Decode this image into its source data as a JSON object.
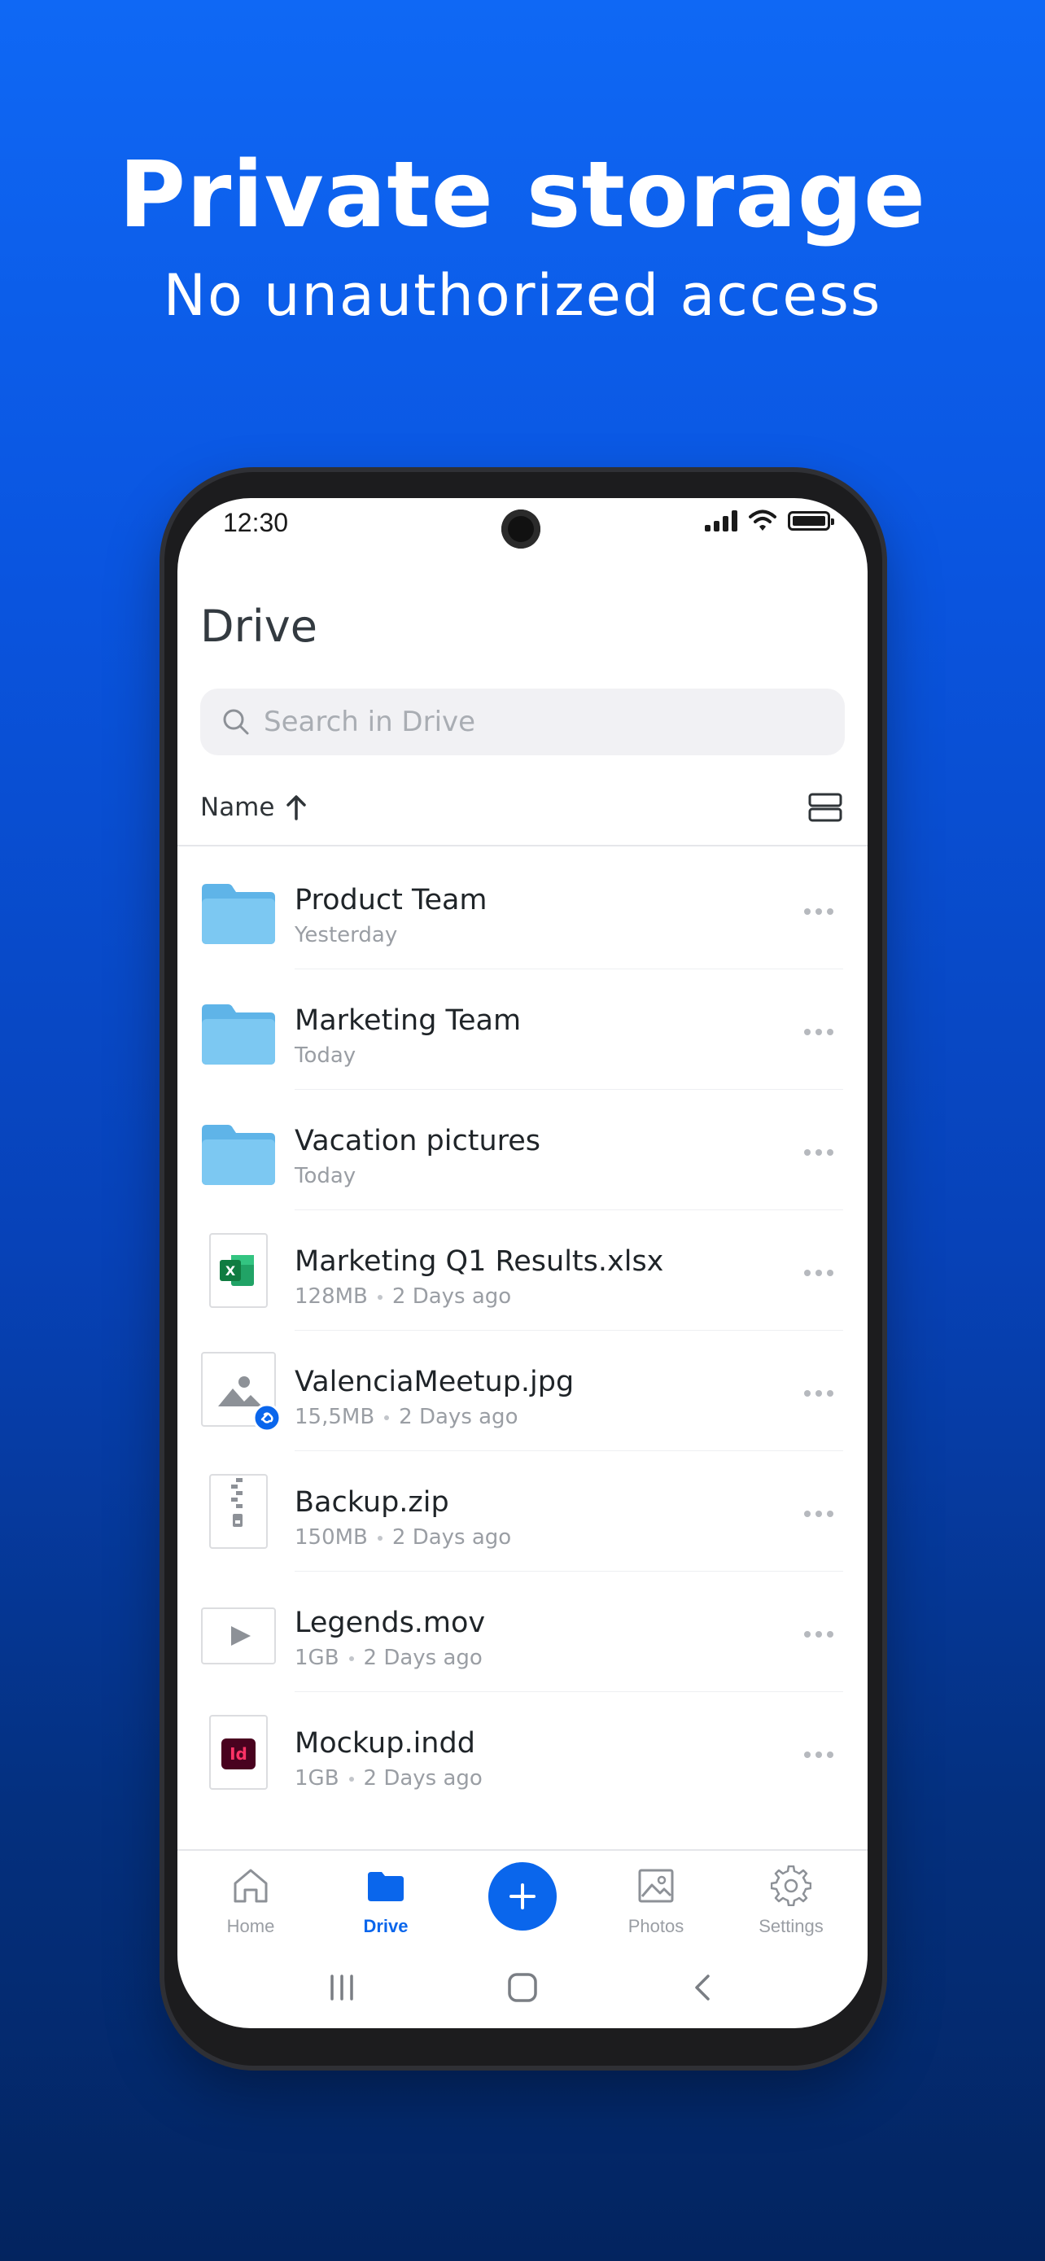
{
  "hero": {
    "headline": "Private storage",
    "subline": "No unauthorized access"
  },
  "status_bar": {
    "time": "12:30"
  },
  "header": {
    "title": "Drive"
  },
  "search": {
    "placeholder": "Search in Drive"
  },
  "sort": {
    "label": "Name"
  },
  "files": [
    {
      "name": "Product Team",
      "meta": "Yesterday",
      "size": "",
      "type": "folder-icon"
    },
    {
      "name": "Marketing Team",
      "meta": "Today",
      "size": "",
      "type": "folder-icon"
    },
    {
      "name": "Vacation pictures",
      "meta": "Today",
      "size": "",
      "type": "folder-icon"
    },
    {
      "name": "Marketing Q1 Results.xlsx",
      "meta": "2 Days ago",
      "size": "128MB",
      "type": "excel-icon"
    },
    {
      "name": "ValenciaMeetup.jpg",
      "meta": "2 Days ago",
      "size": "15,5MB",
      "type": "image-icon"
    },
    {
      "name": "Backup.zip",
      "meta": "2 Days ago",
      "size": "150MB",
      "type": "zip-icon"
    },
    {
      "name": "Legends.mov",
      "meta": "2 Days ago",
      "size": "1GB",
      "type": "video-icon"
    },
    {
      "name": "Mockup.indd",
      "meta": "2 Days ago",
      "size": "1GB",
      "type": "indesign-icon"
    }
  ],
  "tabs": [
    {
      "label": "Home",
      "icon": "home-icon"
    },
    {
      "label": "Drive",
      "icon": "folder-icon"
    },
    {
      "label": "Photos",
      "icon": "photos-icon"
    },
    {
      "label": "Settings",
      "icon": "gear-icon"
    }
  ],
  "colors": {
    "accent": "#0a66ec",
    "folder": "#6ec1ef",
    "background_top": "#0f68f5",
    "background_bottom": "#03245f"
  }
}
